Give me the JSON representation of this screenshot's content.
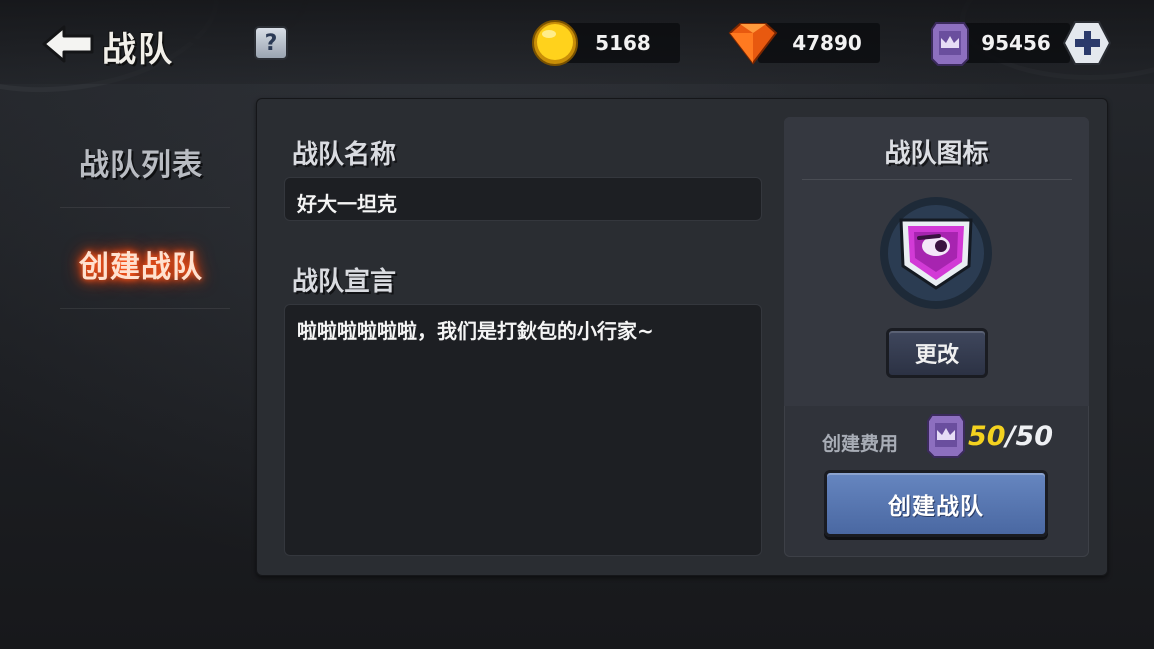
{
  "header": {
    "title": "战队",
    "help_label": "?",
    "currencies": [
      {
        "name": "gold",
        "amount": "5168"
      },
      {
        "name": "gem",
        "amount": "47890"
      },
      {
        "name": "crown-token",
        "amount": "95456"
      }
    ]
  },
  "sidebar": {
    "items": [
      {
        "label": "战队列表",
        "active": false
      },
      {
        "label": "创建战队",
        "active": true
      }
    ]
  },
  "form": {
    "name_label": "战队名称",
    "name_value": "好大一坦克",
    "declaration_label": "战队宣言",
    "declaration_value": "啦啦啦啦啦啦，我们是打鈥包的小行家~"
  },
  "icon_panel": {
    "title": "战队图标",
    "change_label": "更改",
    "cost_label": "创建费用",
    "cost_current": "50",
    "cost_separator": "/",
    "cost_required": "50",
    "create_label": "创建战队"
  },
  "colors": {
    "background": "#1c1e22",
    "panel": "#2a2d32",
    "active_glow": "#ff5a1e",
    "create_button": "#5676b2",
    "cost_highlight": "#f4d21f",
    "emblem_pink": "#d23ad6"
  },
  "icons": [
    "back-arrow-icon",
    "question-icon",
    "gold-coin-icon",
    "gem-icon",
    "crown-token-icon",
    "plus-icon",
    "team-emblem-icon"
  ]
}
